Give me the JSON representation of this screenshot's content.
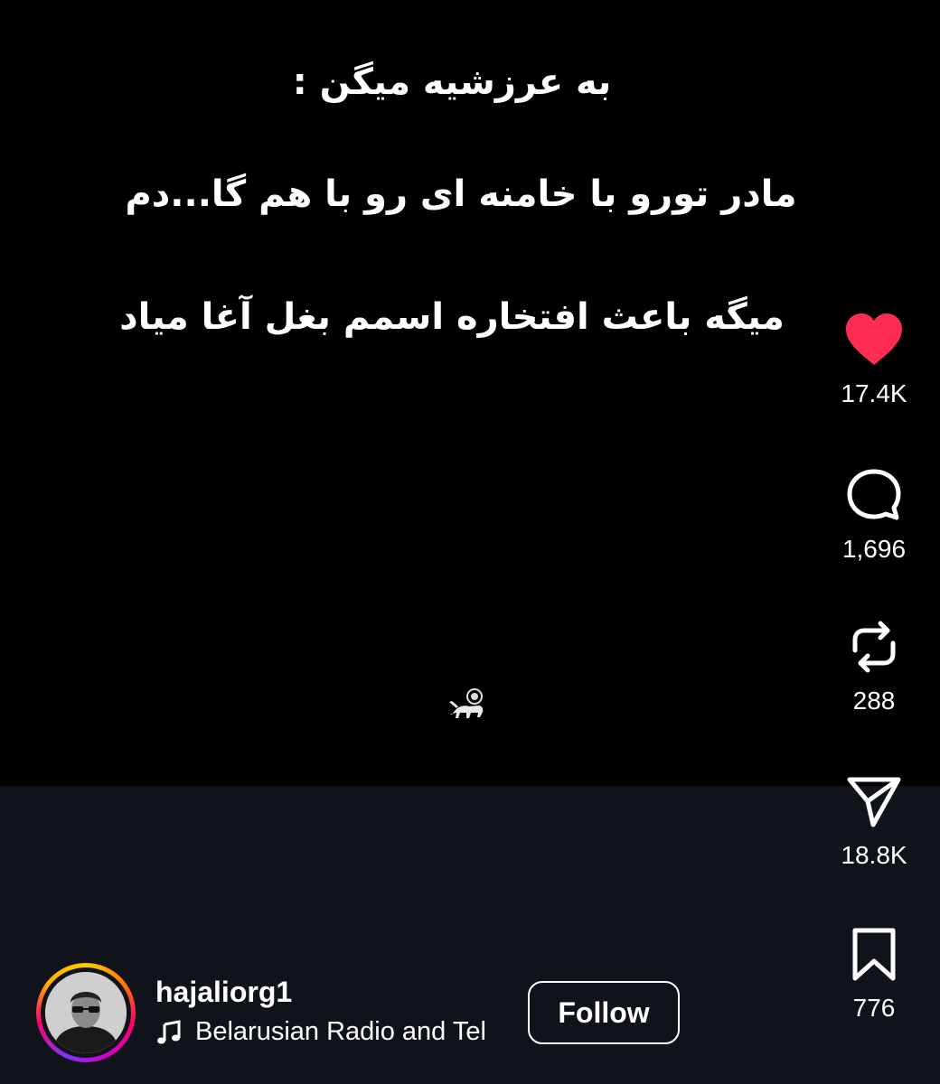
{
  "post": {
    "caption_lines": [
      "به عرزشیه میگن :",
      "مادر تورو با خامنه ای رو با هم گا...دم",
      "میگه باعث افتخاره اسمم بغل آغا میاد"
    ]
  },
  "actions": {
    "likes": "17.4K",
    "comments": "1,696",
    "reposts": "288",
    "shares": "18.8K",
    "saves": "776"
  },
  "author": {
    "username": "hajaliorg1",
    "follow_label": "Follow"
  },
  "audio": {
    "track": "Belarusian Radio and Tel"
  },
  "colors": {
    "like_heart": "#fe2c55",
    "bottom_bar": "#10141a",
    "video_bg": "#000000"
  },
  "icons": {
    "like": "heart-icon",
    "comment": "comment-bubble-icon",
    "repost": "repost-icon",
    "share": "send-icon",
    "save": "bookmark-icon",
    "audio": "music-note-icon",
    "watermark": "lion-and-sun-icon"
  }
}
